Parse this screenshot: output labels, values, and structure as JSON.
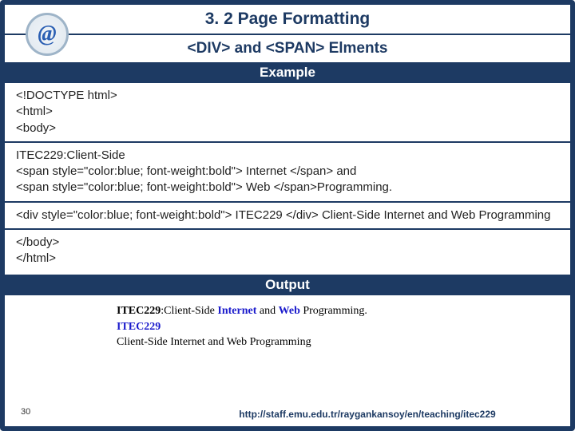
{
  "title": "3. 2 Page Formatting",
  "subtitle": "<DIV> and <SPAN> Elments",
  "sections": {
    "example_label": "Example",
    "output_label": "Output"
  },
  "code": {
    "l1": "<!DOCTYPE html>",
    "l2": "<html>",
    "l3": "<body>",
    "l4": "ITEC229:Client-Side",
    "l5": "<span style=\"color:blue; font-weight:bold\"> Internet </span>  and",
    "l6": "<span style=\"color:blue; font-weight:bold\"> Web </span>Programming.",
    "l7": "<div style=\"color:blue; font-weight:bold\"> ITEC229 </div> Client-Side Internet and Web Programming",
    "l8": "</body>",
    "l9": "</html>"
  },
  "output": {
    "line1_a": "ITEC229",
    "line1_b": ":Client-Side ",
    "line1_c": "Internet",
    "line1_d": " and ",
    "line1_e": "Web",
    "line1_f": " Programming.",
    "line2_a": "ITEC229",
    "line3": "Client-Side Internet and Web Programming"
  },
  "page_number": "30",
  "footer_url": "http://staff.emu.edu.tr/raygankansoy/en/teaching/itec229",
  "icon_name": "at-sign-icon"
}
